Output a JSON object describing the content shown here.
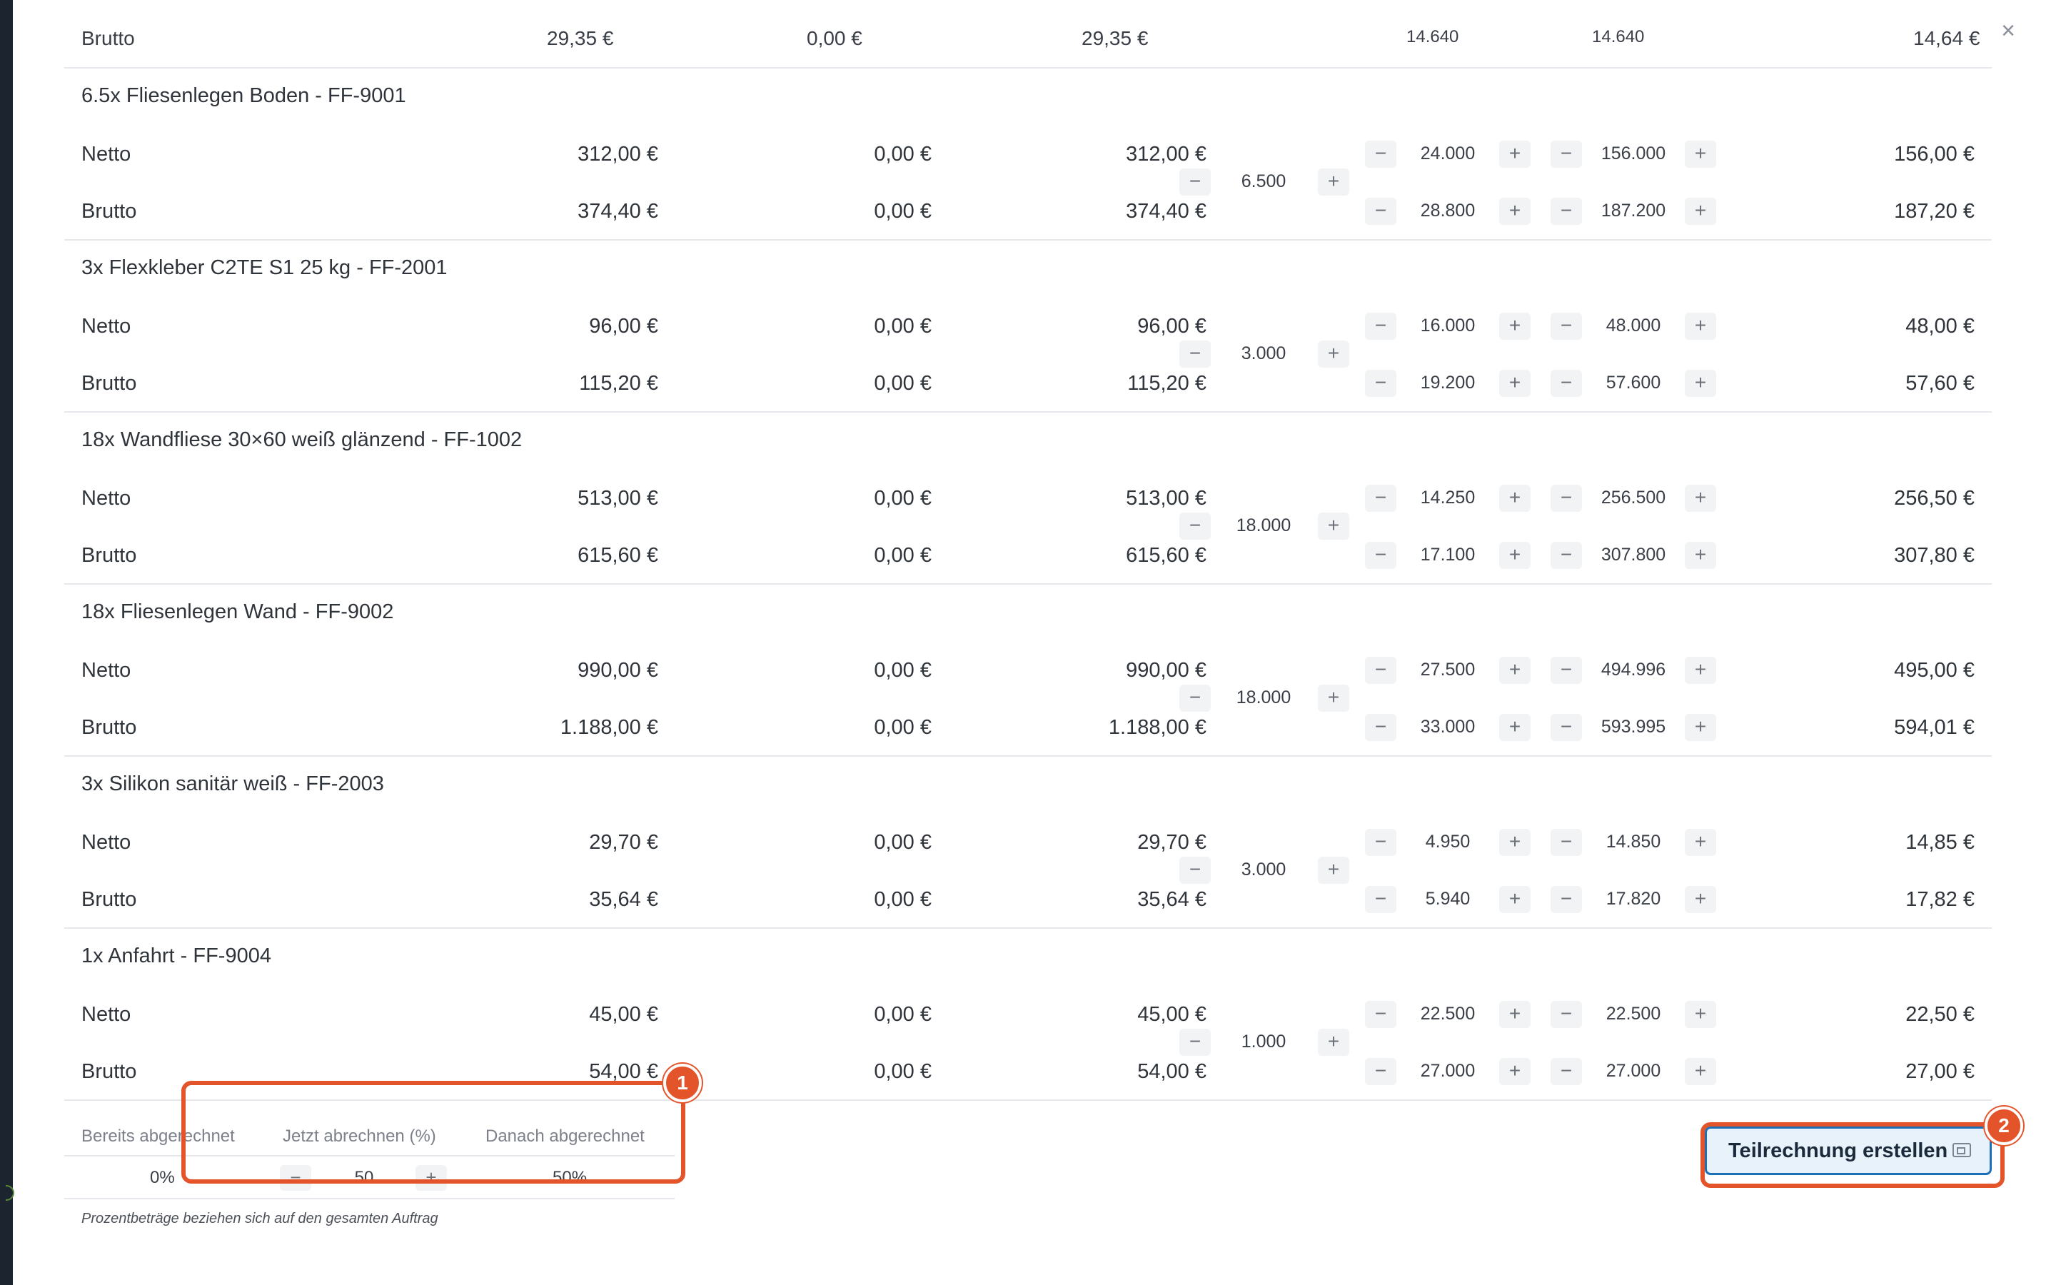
{
  "close_label": "×",
  "top_partial": {
    "label": "Brutto",
    "v1": "29,35 €",
    "v2": "0,00 €",
    "v3": "29,35 €",
    "s1": "14.640",
    "s2": "14.640",
    "total": "14,64 €"
  },
  "items": [
    {
      "title": "6.5x Fliesenlegen Boden - FF-9001",
      "qty": "6.500",
      "netto": {
        "label": "Netto",
        "v1": "312,00 €",
        "v2": "0,00 €",
        "v3": "312,00 €",
        "s1": "24.000",
        "s2": "156.000",
        "total": "156,00 €"
      },
      "brutto": {
        "label": "Brutto",
        "v1": "374,40 €",
        "v2": "0,00 €",
        "v3": "374,40 €",
        "s1": "28.800",
        "s2": "187.200",
        "total": "187,20 €"
      }
    },
    {
      "title": "3x Flexkleber C2TE S1 25 kg - FF-2001",
      "qty": "3.000",
      "netto": {
        "label": "Netto",
        "v1": "96,00 €",
        "v2": "0,00 €",
        "v3": "96,00 €",
        "s1": "16.000",
        "s2": "48.000",
        "total": "48,00 €"
      },
      "brutto": {
        "label": "Brutto",
        "v1": "115,20 €",
        "v2": "0,00 €",
        "v3": "115,20 €",
        "s1": "19.200",
        "s2": "57.600",
        "total": "57,60 €"
      }
    },
    {
      "title": "18x Wandfliese 30×60 weiß glänzend - FF-1002",
      "qty": "18.000",
      "netto": {
        "label": "Netto",
        "v1": "513,00 €",
        "v2": "0,00 €",
        "v3": "513,00 €",
        "s1": "14.250",
        "s2": "256.500",
        "total": "256,50 €"
      },
      "brutto": {
        "label": "Brutto",
        "v1": "615,60 €",
        "v2": "0,00 €",
        "v3": "615,60 €",
        "s1": "17.100",
        "s2": "307.800",
        "total": "307,80 €"
      }
    },
    {
      "title": "18x Fliesenlegen Wand - FF-9002",
      "qty": "18.000",
      "netto": {
        "label": "Netto",
        "v1": "990,00 €",
        "v2": "0,00 €",
        "v3": "990,00 €",
        "s1": "27.500",
        "s2": "494.996",
        "total": "495,00 €"
      },
      "brutto": {
        "label": "Brutto",
        "v1": "1.188,00 €",
        "v2": "0,00 €",
        "v3": "1.188,00 €",
        "s1": "33.000",
        "s2": "593.995",
        "total": "594,01 €"
      }
    },
    {
      "title": "3x Silikon sanitär weiß - FF-2003",
      "qty": "3.000",
      "netto": {
        "label": "Netto",
        "v1": "29,70 €",
        "v2": "0,00 €",
        "v3": "29,70 €",
        "s1": "4.950",
        "s2": "14.850",
        "total": "14,85 €"
      },
      "brutto": {
        "label": "Brutto",
        "v1": "35,64 €",
        "v2": "0,00 €",
        "v3": "35,64 €",
        "s1": "5.940",
        "s2": "17.820",
        "total": "17,82 €"
      }
    },
    {
      "title": "1x Anfahrt - FF-9004",
      "qty": "1.000",
      "netto": {
        "label": "Netto",
        "v1": "45,00 €",
        "v2": "0,00 €",
        "v3": "45,00 €",
        "s1": "22.500",
        "s2": "22.500",
        "total": "22,50 €"
      },
      "brutto": {
        "label": "Brutto",
        "v1": "54,00 €",
        "v2": "0,00 €",
        "v3": "54,00 €",
        "s1": "27.000",
        "s2": "27.000",
        "total": "27,00 €"
      }
    }
  ],
  "summary": {
    "header_billed": "Bereits abgerechnet",
    "header_now": "Jetzt abrechnen (%)",
    "header_after": "Danach abgerechnet",
    "billed": "0%",
    "now": "50",
    "after": "50%",
    "note": "Prozentbeträge beziehen sich auf den gesamten Auftrag"
  },
  "button": {
    "label": "Teilrechnung erstellen"
  },
  "badges": {
    "first": "1",
    "second": "2"
  },
  "colors": {
    "highlight": "#e4542b",
    "button_border": "#1d6fb8",
    "button_bg": "#e8f2fa"
  },
  "icons": {
    "close": "close-icon",
    "minus": "minus-icon",
    "plus": "plus-icon",
    "invoice": "invoice-icon"
  }
}
